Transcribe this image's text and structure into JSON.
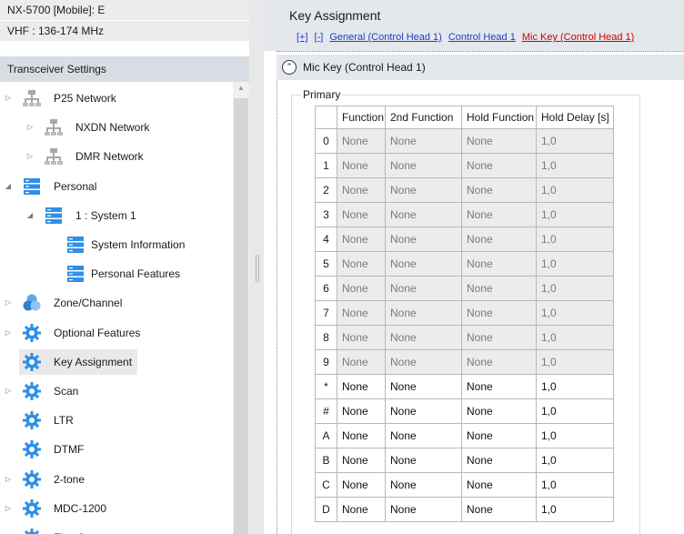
{
  "device": {
    "model": "NX-5700 [Mobile]: E",
    "band": "VHF : 136-174 MHz"
  },
  "settings_panel": {
    "header": "Transceiver Settings",
    "tree": [
      {
        "label": "P25 Network",
        "icon": "network-icon",
        "expander": "collapsed"
      },
      {
        "label": "NXDN Network",
        "icon": "network-icon",
        "expander": "collapsed"
      },
      {
        "label": "DMR Network",
        "icon": "network-icon",
        "expander": "collapsed"
      },
      {
        "label": "Personal",
        "icon": "server-icon",
        "expander": "expanded"
      },
      {
        "label": "1 : System 1",
        "icon": "server-icon",
        "expander": "expanded"
      },
      {
        "label": "System Information",
        "icon": "server-icon",
        "expander": "none"
      },
      {
        "label": "Personal Features",
        "icon": "server-icon",
        "expander": "none"
      },
      {
        "label": "Zone/Channel",
        "icon": "zone-icon",
        "expander": "collapsed"
      },
      {
        "label": "Optional Features",
        "icon": "gear-icon",
        "expander": "collapsed"
      },
      {
        "label": "Key Assignment",
        "icon": "gear-icon",
        "expander": "none",
        "selected": true
      },
      {
        "label": "Scan",
        "icon": "gear-icon",
        "expander": "collapsed"
      },
      {
        "label": "LTR",
        "icon": "gear-icon",
        "expander": "none"
      },
      {
        "label": "DTMF",
        "icon": "gear-icon",
        "expander": "none"
      },
      {
        "label": "2-tone",
        "icon": "gear-icon",
        "expander": "collapsed"
      },
      {
        "label": "MDC-1200",
        "icon": "gear-icon",
        "expander": "collapsed"
      },
      {
        "label": "FleetSync",
        "icon": "gear-icon",
        "expander": "collapsed"
      }
    ]
  },
  "key_assignment": {
    "title": "Key Assignment",
    "links": [
      {
        "label": "[+]",
        "color": "blue"
      },
      {
        "label": "[-]",
        "color": "blue"
      },
      {
        "label": "General (Control Head 1)",
        "color": "blue"
      },
      {
        "label": "Control Head 1",
        "color": "blue"
      },
      {
        "label": "Mic Key (Control Head 1)",
        "color": "red"
      }
    ],
    "section_title": "Mic Key (Control Head 1)",
    "group_label": "Primary",
    "columns": [
      "",
      "Function",
      "2nd Function",
      "Hold Function",
      "Hold Delay [s]"
    ],
    "rows": [
      {
        "key": "0",
        "function": "None",
        "second": "None",
        "hold": "None",
        "delay": "1,0",
        "enabled": false
      },
      {
        "key": "1",
        "function": "None",
        "second": "None",
        "hold": "None",
        "delay": "1,0",
        "enabled": false
      },
      {
        "key": "2",
        "function": "None",
        "second": "None",
        "hold": "None",
        "delay": "1,0",
        "enabled": false
      },
      {
        "key": "3",
        "function": "None",
        "second": "None",
        "hold": "None",
        "delay": "1,0",
        "enabled": false
      },
      {
        "key": "4",
        "function": "None",
        "second": "None",
        "hold": "None",
        "delay": "1,0",
        "enabled": false
      },
      {
        "key": "5",
        "function": "None",
        "second": "None",
        "hold": "None",
        "delay": "1,0",
        "enabled": false
      },
      {
        "key": "6",
        "function": "None",
        "second": "None",
        "hold": "None",
        "delay": "1,0",
        "enabled": false
      },
      {
        "key": "7",
        "function": "None",
        "second": "None",
        "hold": "None",
        "delay": "1,0",
        "enabled": false
      },
      {
        "key": "8",
        "function": "None",
        "second": "None",
        "hold": "None",
        "delay": "1,0",
        "enabled": false
      },
      {
        "key": "9",
        "function": "None",
        "second": "None",
        "hold": "None",
        "delay": "1,0",
        "enabled": false
      },
      {
        "key": "*",
        "function": "None",
        "second": "None",
        "hold": "None",
        "delay": "1,0",
        "enabled": true
      },
      {
        "key": "#",
        "function": "None",
        "second": "None",
        "hold": "None",
        "delay": "1,0",
        "enabled": true
      },
      {
        "key": "A",
        "function": "None",
        "second": "None",
        "hold": "None",
        "delay": "1,0",
        "enabled": true
      },
      {
        "key": "B",
        "function": "None",
        "second": "None",
        "hold": "None",
        "delay": "1,0",
        "enabled": true
      },
      {
        "key": "C",
        "function": "None",
        "second": "None",
        "hold": "None",
        "delay": "1,0",
        "enabled": true
      },
      {
        "key": "D",
        "function": "None",
        "second": "None",
        "hold": "None",
        "delay": "1,0",
        "enabled": true
      }
    ]
  },
  "colors": {
    "link_blue": "#1f3fc8",
    "link_red": "#d00000",
    "disabled_cell_bg": "#ececec",
    "header_bg": "#e4e7eb",
    "icon_blue": "#2f8fe8"
  }
}
